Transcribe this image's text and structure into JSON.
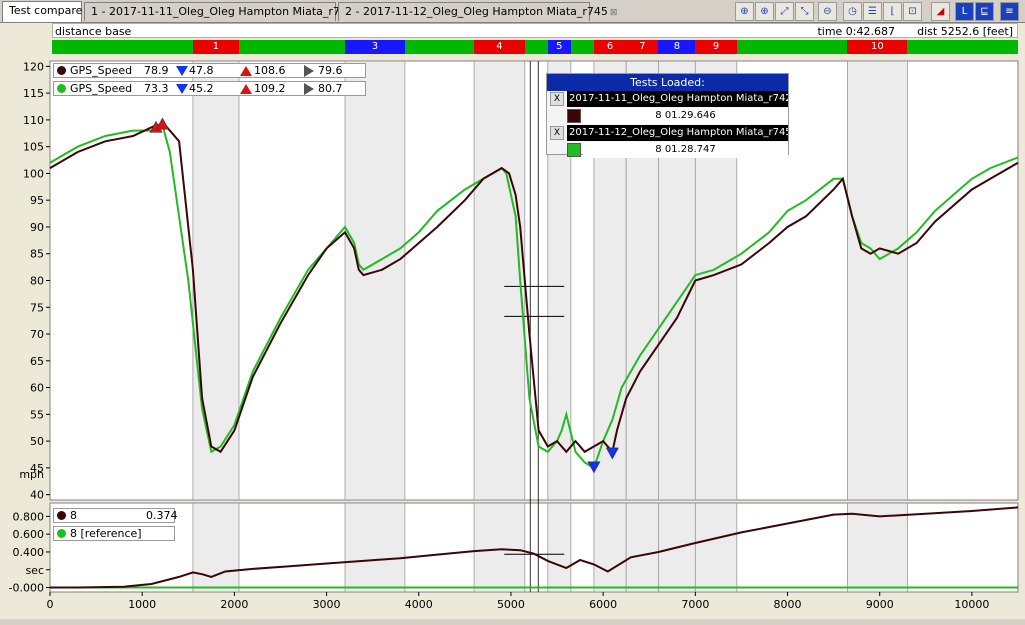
{
  "tabs": [
    {
      "label": "Test compare",
      "active": true,
      "close": ""
    },
    {
      "label": "1 - 2017-11-11_Oleg_Oleg Hampton Miata_r742",
      "active": false,
      "close": "⊠"
    },
    {
      "label": "2 - 2017-11-12_Oleg_Oleg Hampton Miata_r745",
      "active": false,
      "close": "⊠"
    }
  ],
  "toolbar": [
    {
      "name": "zoom-2d-button",
      "glyph": "⊕",
      "style": "normal"
    },
    {
      "name": "zoom-in-button",
      "glyph": "⊕",
      "style": "normal"
    },
    {
      "name": "zoom-fit-button",
      "glyph": "⤢",
      "style": "normal"
    },
    {
      "name": "zoom-area-button",
      "glyph": "⤡",
      "style": "normal"
    },
    {
      "name": "zoom-out-button",
      "glyph": "⊖",
      "style": "normal"
    },
    {
      "name": "clock-button",
      "glyph": "◷",
      "style": "normal"
    },
    {
      "name": "channels-button",
      "glyph": "☰",
      "style": "normal"
    },
    {
      "name": "chart-type-button",
      "glyph": "⌊",
      "style": "normal"
    },
    {
      "name": "overlay-button",
      "glyph": "⊡",
      "style": "normal"
    },
    {
      "name": "marker-button",
      "glyph": "◢",
      "style": "red"
    },
    {
      "name": "axis-l-button",
      "glyph": "L",
      "style": "blue"
    },
    {
      "name": "axis-lines-button",
      "glyph": "⊑",
      "style": "blue"
    },
    {
      "name": "list-button",
      "glyph": "≡",
      "style": "blue"
    }
  ],
  "status": {
    "base": "distance base",
    "time": "time 0:42.687",
    "dist": "dist 5252.6 [feet]"
  },
  "segments": [
    {
      "label": "1",
      "start": 1550,
      "end": 2050,
      "color": "#ea0000"
    },
    {
      "label": "3",
      "start": 3200,
      "end": 3850,
      "color": "#1818ff"
    },
    {
      "label": "4",
      "start": 4600,
      "end": 5150,
      "color": "#ea0000"
    },
    {
      "label": "5",
      "start": 5400,
      "end": 5650,
      "color": "#1818ff"
    },
    {
      "label": "6",
      "start": 5900,
      "end": 6250,
      "color": "#ea0000"
    },
    {
      "label": "7",
      "start": 6250,
      "end": 6600,
      "color": "#ea0000"
    },
    {
      "label": "8",
      "start": 6600,
      "end": 7000,
      "color": "#1818ff"
    },
    {
      "label": "9",
      "start": 7000,
      "end": 7450,
      "color": "#ea0000"
    },
    {
      "label": "10",
      "start": 8650,
      "end": 9300,
      "color": "#ea0000"
    }
  ],
  "legend_top": [
    {
      "name": "GPS_Speed",
      "value": "78.9",
      "min": "47.8",
      "max": "108.6",
      "cur": "79.6",
      "color": "#3a0606"
    },
    {
      "name": "GPS_Speed",
      "value": "73.3",
      "min": "45.2",
      "max": "109.2",
      "cur": "80.7",
      "color": "#22bb22"
    }
  ],
  "legend_bottom": [
    {
      "name": "8",
      "value": "0.374",
      "color": "#3a0606"
    },
    {
      "name": "8 [reference]",
      "value": "",
      "color": "#22bb22"
    }
  ],
  "tests_panel": {
    "title": "Tests Loaded:",
    "items": [
      {
        "close": "X",
        "name": "2017-11-11_Oleg_Oleg Hampton Miata_r742",
        "time": "8 01.29.646",
        "color": "#3a0606"
      },
      {
        "close": "X",
        "name": "2017-11-12_Oleg_Oleg Hampton Miata_r745",
        "time": "8 01.28.747",
        "color": "#22bb22"
      }
    ]
  },
  "chart_data": [
    {
      "type": "line",
      "xlim": [
        0,
        10500
      ],
      "ylim": [
        39,
        121
      ],
      "ylabel": "mph",
      "yticks": [
        40,
        45,
        50,
        55,
        60,
        65,
        70,
        75,
        80,
        85,
        90,
        95,
        100,
        105,
        110,
        115,
        120
      ],
      "series": [
        {
          "name": "GPS_Speed",
          "color": "#3a0606",
          "x": [
            0,
            300,
            600,
            900,
            1150,
            1250,
            1400,
            1550,
            1650,
            1750,
            1850,
            2000,
            2200,
            2500,
            2800,
            3000,
            3200,
            3300,
            3350,
            3400,
            3600,
            3800,
            4000,
            4200,
            4500,
            4700,
            4900,
            4980,
            5050,
            5100,
            5200,
            5300,
            5400,
            5500,
            5600,
            5700,
            5800,
            5900,
            6000,
            6100,
            6150,
            6250,
            6400,
            6600,
            6800,
            7000,
            7200,
            7500,
            7800,
            8000,
            8200,
            8500,
            8600,
            8700,
            8800,
            8900,
            9000,
            9200,
            9400,
            9600,
            9800,
            10000,
            10200,
            10500
          ],
          "values": [
            101,
            104,
            106,
            107,
            109,
            109,
            106,
            82,
            58,
            49,
            48,
            52,
            62,
            72,
            81,
            86,
            89,
            86,
            82,
            81,
            82,
            84,
            87,
            90,
            95,
            99,
            101,
            100,
            96,
            90,
            70,
            52,
            49,
            50,
            48,
            50,
            48,
            49,
            50,
            48,
            52,
            58,
            63,
            68,
            73,
            80,
            81,
            83,
            87,
            90,
            92,
            97,
            99,
            92,
            86,
            85,
            86,
            85,
            87,
            91,
            94,
            97,
            99,
            102
          ]
        },
        {
          "name": "GPS_Speed",
          "color": "#22bb22",
          "x": [
            0,
            300,
            600,
            900,
            1150,
            1220,
            1300,
            1500,
            1650,
            1750,
            1850,
            2000,
            2200,
            2500,
            2800,
            3000,
            3200,
            3300,
            3350,
            3400,
            3600,
            3800,
            4000,
            4200,
            4500,
            4700,
            4900,
            4950,
            5050,
            5100,
            5200,
            5300,
            5400,
            5500,
            5550,
            5600,
            5700,
            5800,
            5900,
            6000,
            6100,
            6200,
            6400,
            6600,
            6800,
            7000,
            7200,
            7500,
            7800,
            8000,
            8200,
            8500,
            8600,
            8700,
            8800,
            8900,
            9000,
            9200,
            9400,
            9600,
            9800,
            10000,
            10200,
            10500
          ],
          "values": [
            102,
            105,
            107,
            108,
            108,
            109,
            104,
            80,
            56,
            48,
            49,
            53,
            63,
            73,
            82,
            86,
            90,
            87,
            83,
            82,
            84,
            86,
            89,
            93,
            97,
            99,
            101,
            100,
            92,
            80,
            58,
            49,
            48,
            50,
            52,
            55,
            48,
            46,
            45,
            50,
            54,
            60,
            66,
            71,
            76,
            81,
            82,
            85,
            89,
            93,
            95,
            99,
            99,
            92,
            87,
            86,
            84,
            86,
            89,
            93,
            96,
            99,
            101,
            103
          ]
        }
      ],
      "markers": [
        {
          "series": 0,
          "x": 1150,
          "y": 108.6,
          "type": "max",
          "color": "#dd1111"
        },
        {
          "series": 1,
          "x": 1220,
          "y": 109.2,
          "type": "max",
          "color": "#dd1111"
        },
        {
          "series": 0,
          "x": 6100,
          "y": 47.8,
          "type": "min",
          "color": "#1133ee"
        },
        {
          "series": 1,
          "x": 5900,
          "y": 45.2,
          "type": "min",
          "color": "#1133ee"
        }
      ]
    },
    {
      "type": "line",
      "xlim": [
        0,
        10500
      ],
      "ylim": [
        -0.05,
        0.95
      ],
      "ylabel": "sec",
      "yticks": [
        -0.0,
        0.2,
        0.4,
        0.6,
        0.8
      ],
      "ytick_labels": [
        "-0.000",
        "",
        "0.400",
        "0.600",
        "0.800"
      ],
      "xticks": [
        0,
        1000,
        2000,
        3000,
        4000,
        5000,
        6000,
        7000,
        8000,
        9000,
        10000
      ],
      "series": [
        {
          "name": "8",
          "color": "#3a0606",
          "x": [
            0,
            300,
            800,
            1100,
            1400,
            1550,
            1650,
            1750,
            1900,
            2200,
            2600,
            3000,
            3400,
            3800,
            4200,
            4600,
            4900,
            5100,
            5250,
            5400,
            5600,
            5750,
            5900,
            6050,
            6300,
            6600,
            7000,
            7500,
            8000,
            8500,
            8700,
            9000,
            9500,
            10000,
            10500
          ],
          "values": [
            0,
            0,
            0.01,
            0.04,
            0.12,
            0.17,
            0.15,
            0.12,
            0.18,
            0.21,
            0.24,
            0.27,
            0.3,
            0.33,
            0.37,
            0.41,
            0.43,
            0.42,
            0.38,
            0.3,
            0.22,
            0.31,
            0.26,
            0.18,
            0.34,
            0.4,
            0.5,
            0.62,
            0.72,
            0.82,
            0.83,
            0.8,
            0.83,
            0.86,
            0.9
          ]
        },
        {
          "name": "8 [reference]",
          "color": "#22bb22",
          "x": [
            0,
            10500
          ],
          "values": [
            0,
            0
          ]
        }
      ]
    }
  ]
}
